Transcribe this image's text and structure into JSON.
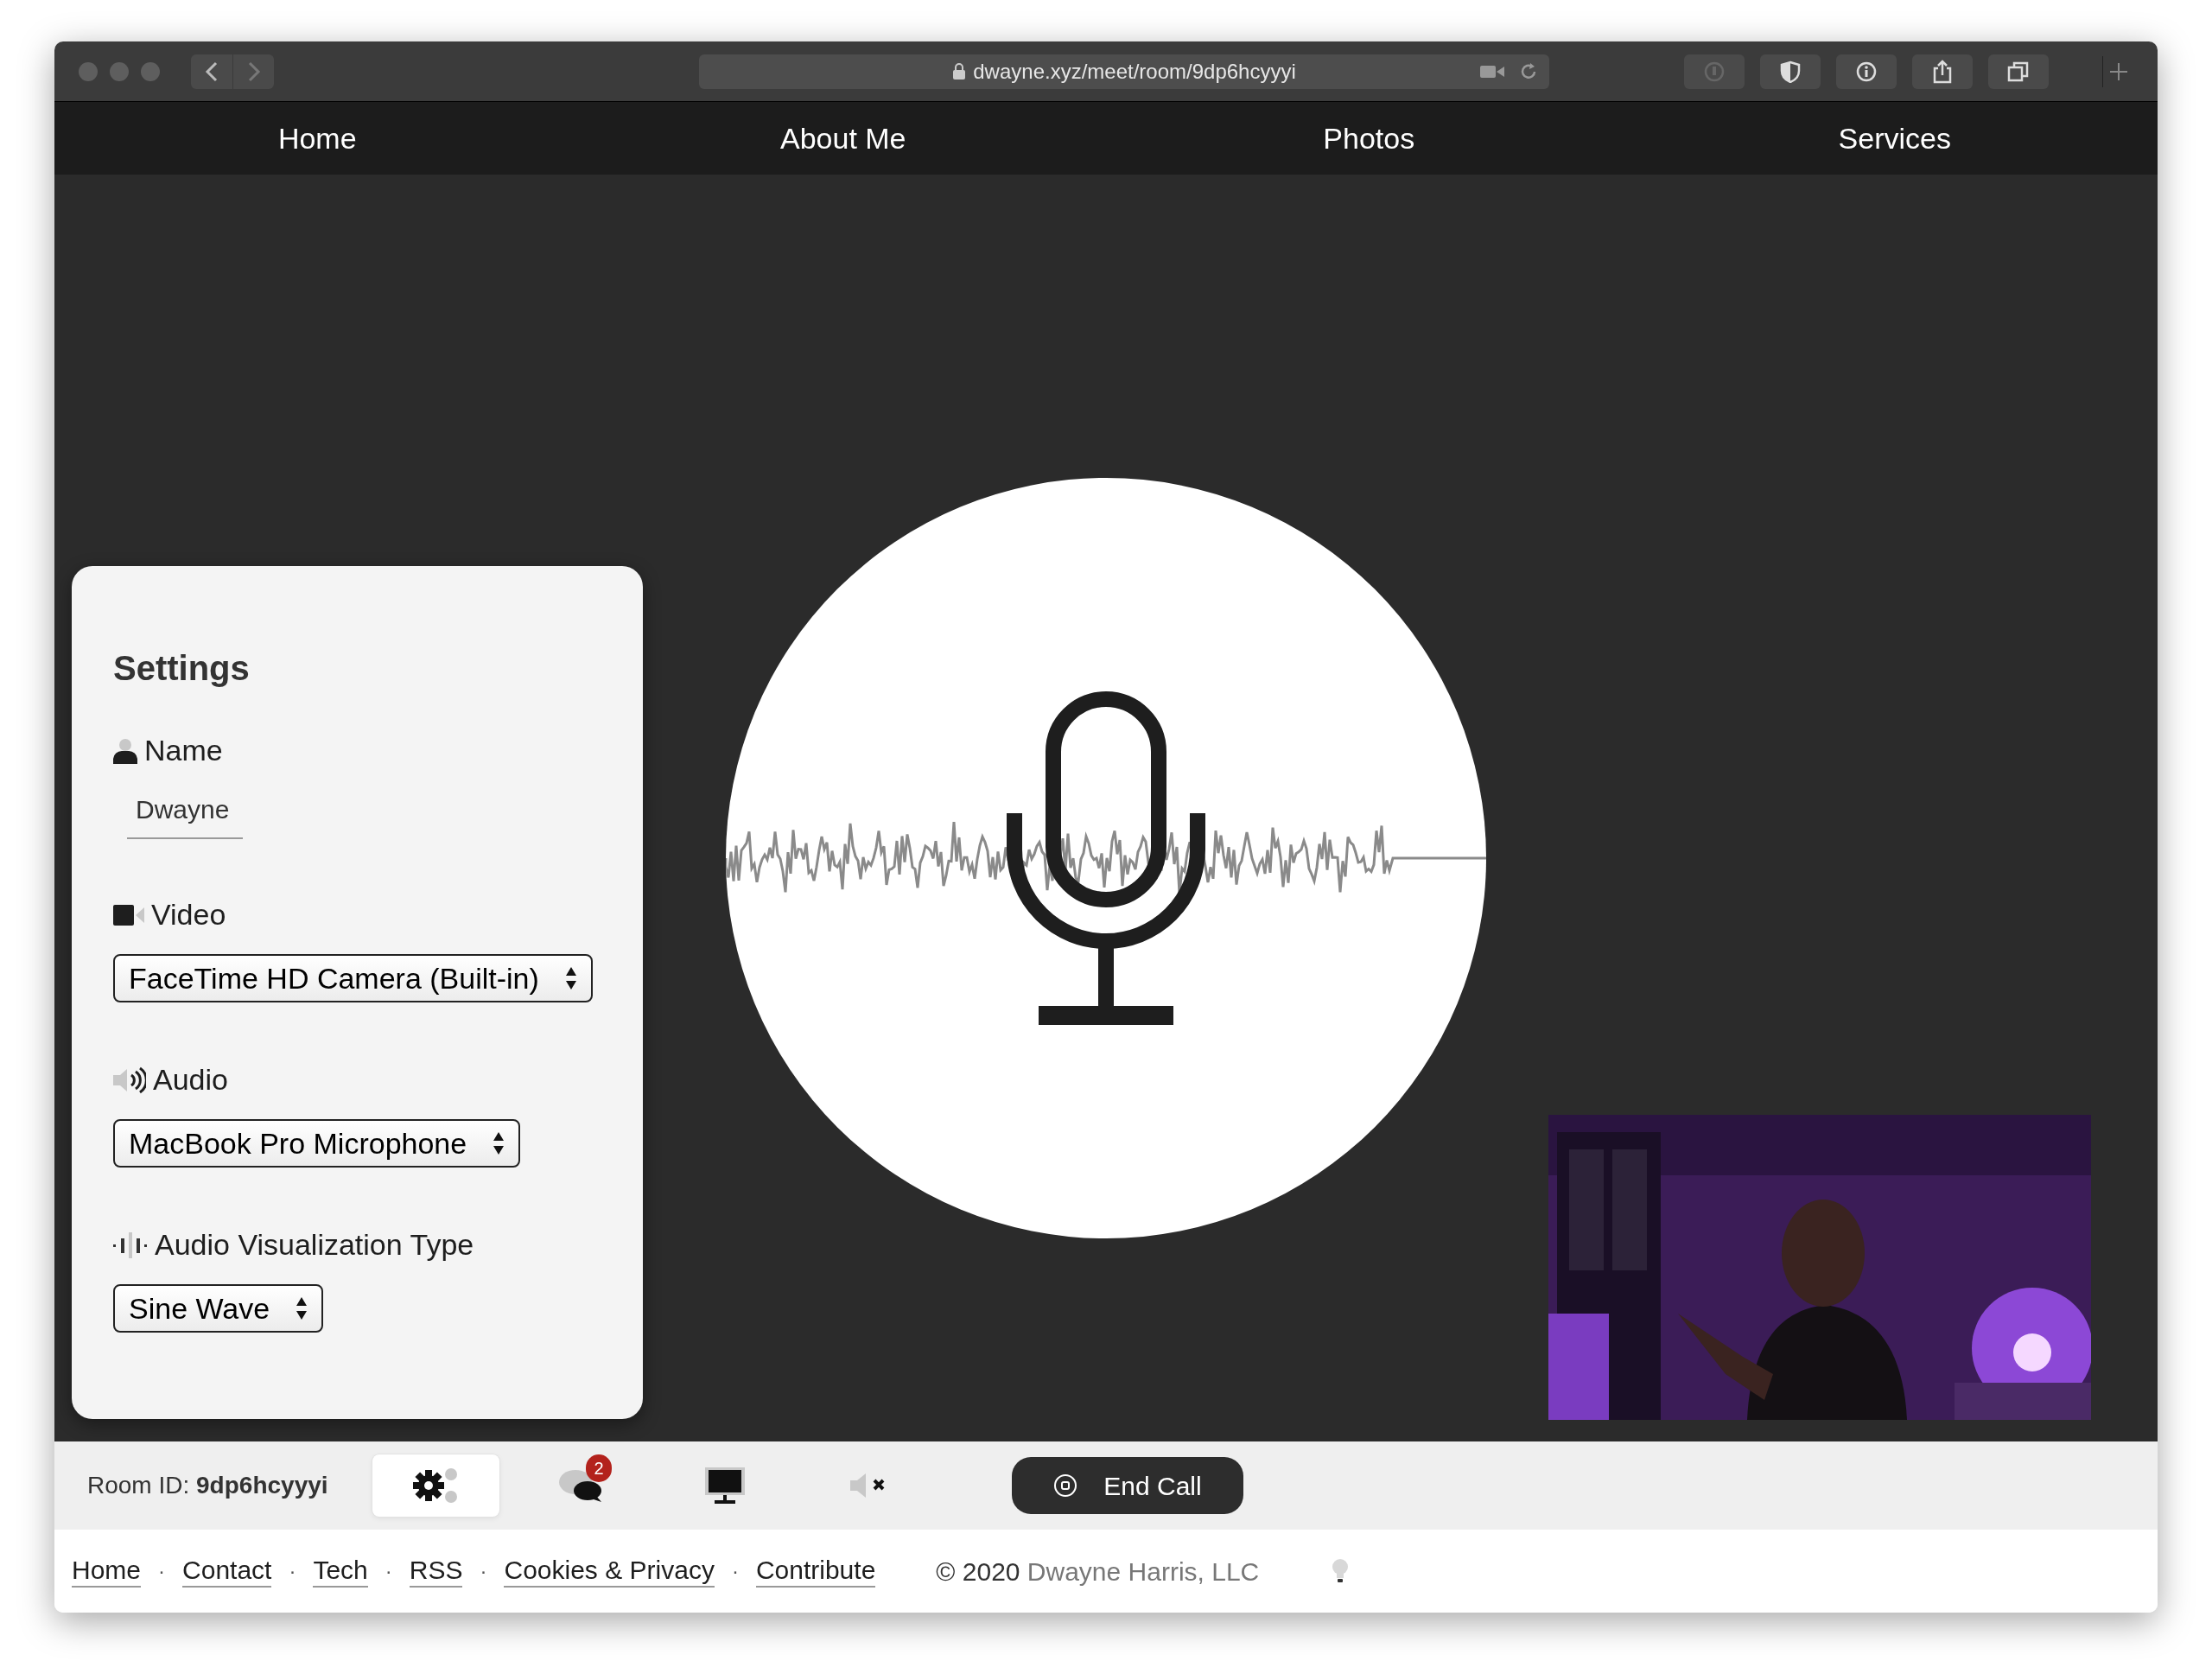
{
  "browser": {
    "url": "dwayne.xyz/meet/room/9dp6hcyyyi"
  },
  "nav": [
    "Home",
    "About Me",
    "Photos",
    "Services"
  ],
  "settings": {
    "title": "Settings",
    "fields": [
      {
        "kind": "text",
        "label": "Name",
        "value": "Dwayne"
      },
      {
        "kind": "select",
        "label": "Video",
        "value": "FaceTime HD Camera (Built-in)"
      },
      {
        "kind": "select",
        "label": "Audio",
        "value": "MacBook Pro Microphone"
      },
      {
        "kind": "select",
        "label": "Audio Visualization Type",
        "value": "Sine Wave"
      }
    ]
  },
  "controls": {
    "room_id": "Room ID: **9dp6hcyyyi**",
    "buttons": [
      {
        "selected": true
      },
      {
        "selected": false,
        "badge": "2"
      },
      {
        "selected": false
      },
      {
        "selected": false
      }
    ],
    "end_call": "End Call"
  },
  "footer": {
    "items": [
      {
        "kind": "link",
        "text": "Home"
      },
      {
        "kind": "separator",
        "text": "·"
      },
      {
        "kind": "link",
        "text": "Contact"
      },
      {
        "kind": "separator",
        "text": "·"
      },
      {
        "kind": "link",
        "text": "Tech"
      },
      {
        "kind": "separator",
        "text": "·"
      },
      {
        "kind": "link",
        "text": "RSS"
      },
      {
        "kind": "separator",
        "text": "·"
      },
      {
        "kind": "link",
        "text": "Cookies & Privacy"
      },
      {
        "kind": "separator",
        "text": "·"
      },
      {
        "kind": "link",
        "text": "Contribute"
      }
    ],
    "copyright": "© 2020",
    "owner": "Dwayne Harris, LLC"
  }
}
